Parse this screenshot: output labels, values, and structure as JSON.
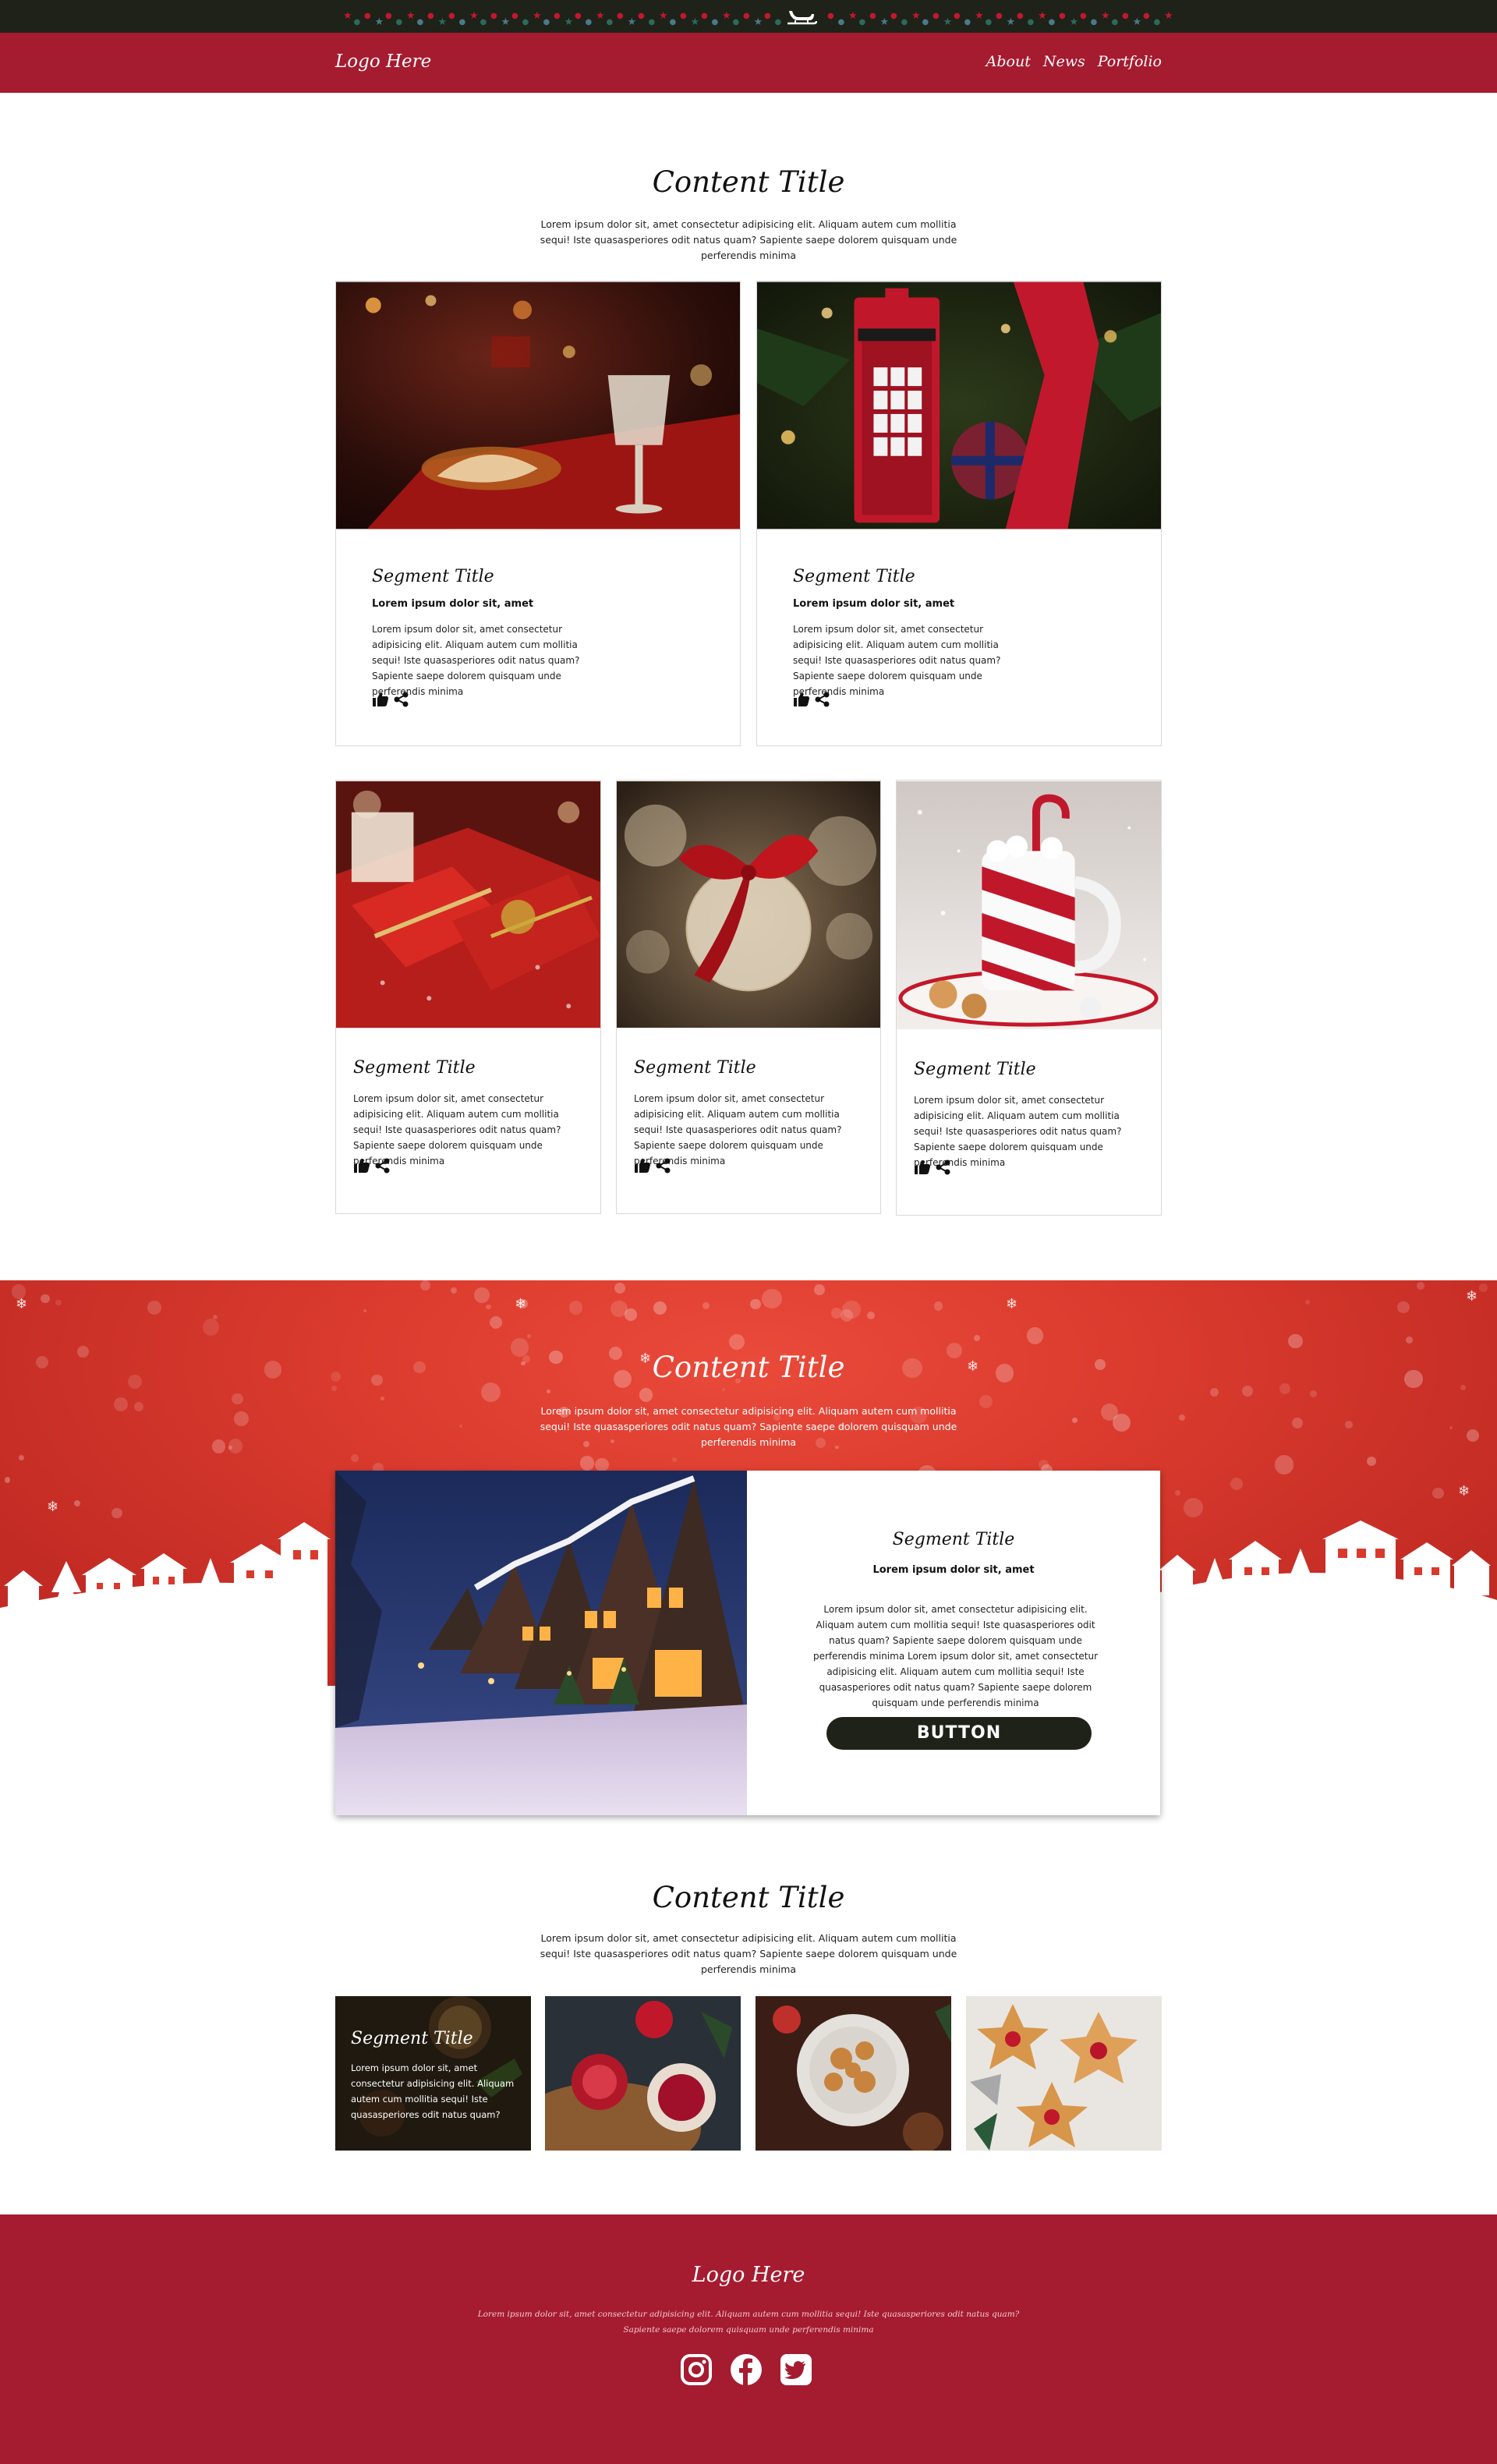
{
  "header": {
    "logo": "Logo Here",
    "nav": [
      "About",
      "News",
      "Portfolio"
    ]
  },
  "section1": {
    "title": "Content Title",
    "intro": "Lorem ipsum dolor sit, amet consectetur adipisicing elit. Aliquam autem cum mollitia sequi! Iste quasasperiores odit natus quam? Sapiente saepe dolorem quisquam unde perferendis minima",
    "cards_top": [
      {
        "title": "Segment Title",
        "subtitle": "Lorem ipsum dolor sit, amet",
        "body": "Lorem ipsum dolor sit, amet consectetur adipisicing elit. Aliquam autem cum mollitia sequi! Iste quasasperiores odit natus quam? Sapiente saepe dolorem quisquam unde perferendis minima"
      },
      {
        "title": "Segment Title",
        "subtitle": "Lorem ipsum dolor sit, amet",
        "body": "Lorem ipsum dolor sit, amet consectetur adipisicing elit. Aliquam autem cum mollitia sequi! Iste quasasperiores odit natus quam? Sapiente saepe dolorem quisquam unde perferendis minima"
      }
    ],
    "cards_bottom": [
      {
        "title": "Segment Title",
        "body": "Lorem ipsum dolor sit, amet consectetur adipisicing elit. Aliquam autem cum mollitia sequi! Iste quasasperiores odit natus quam? Sapiente saepe dolorem quisquam unde perferendis minima"
      },
      {
        "title": "Segment Title",
        "body": "Lorem ipsum dolor sit, amet consectetur adipisicing elit. Aliquam autem cum mollitia sequi! Iste quasasperiores odit natus quam? Sapiente saepe dolorem quisquam unde perferendis minima"
      },
      {
        "title": "Segment Title",
        "body": "Lorem ipsum dolor sit, amet consectetur adipisicing elit. Aliquam autem cum mollitia sequi! Iste quasasperiores odit natus quam? Sapiente saepe dolorem quisquam unde perferendis minima"
      }
    ]
  },
  "banner": {
    "title": "Content Title",
    "intro": "Lorem ipsum dolor sit, amet consectetur adipisicing elit. Aliquam autem cum mollitia sequi! Iste quasasperiores odit natus quam? Sapiente saepe dolorem quisquam unde perferendis minima",
    "feature": {
      "title": "Segment Title",
      "subtitle": "Lorem ipsum dolor sit, amet",
      "body": "Lorem ipsum dolor sit, amet consectetur adipisicing elit. Aliquam autem cum mollitia sequi! Iste quasasperiores odit natus quam? Sapiente saepe dolorem quisquam unde perferendis minima Lorem ipsum dolor sit, amet consectetur adipisicing elit. Aliquam autem cum mollitia sequi! Iste quasasperiores odit natus quam? Sapiente saepe dolorem quisquam unde perferendis minima",
      "button": "BUTTON"
    }
  },
  "section3": {
    "title": "Content Title",
    "intro": "Lorem ipsum dolor sit, amet consectetur adipisicing elit. Aliquam autem cum mollitia sequi! Iste quasasperiores odit natus quam? Sapiente saepe dolorem quisquam unde perferendis minima",
    "overlay_tile": {
      "title": "Segment Title",
      "body": "Lorem ipsum dolor sit, amet consectetur adipisicing elit. Aliquam autem cum mollitia sequi! Iste quasasperiores odit natus quam?"
    }
  },
  "footer": {
    "logo": "Logo Here",
    "text": "Lorem ipsum dolor sit, amet consectetur adipisicing elit. Aliquam autem cum mollitia sequi! Iste quasasperiores odit natus quam? Sapiente saepe dolorem quisquam unde perferendis minima",
    "social": [
      "instagram-icon",
      "facebook-icon",
      "twitter-icon"
    ]
  },
  "colors": {
    "brand_red": "#a51b30",
    "banner_red": "#d93a2d",
    "dark": "#1f2219"
  }
}
